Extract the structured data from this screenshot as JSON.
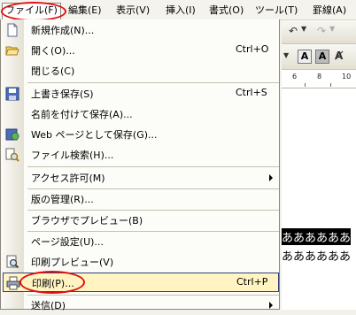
{
  "menubar": {
    "items": [
      {
        "label": "ファイル(F)"
      },
      {
        "label": "編集(E)"
      },
      {
        "label": "表示(V)"
      },
      {
        "label": "挿入(I)"
      },
      {
        "label": "書式(O)"
      },
      {
        "label": "ツール(T)"
      },
      {
        "label": "罫線(A)"
      }
    ]
  },
  "file_menu": {
    "items": [
      {
        "label": "新規作成(N)...",
        "shortcut": "",
        "icon": "new-doc-icon"
      },
      {
        "label": "開く(O)...",
        "shortcut": "Ctrl+O",
        "icon": "open-folder-icon"
      },
      {
        "label": "閉じる(C)",
        "shortcut": ""
      },
      {
        "label": "上書き保存(S)",
        "shortcut": "Ctrl+S",
        "icon": "save-disk-icon"
      },
      {
        "label": "名前を付けて保存(A)...",
        "shortcut": ""
      },
      {
        "label": "Web ページとして保存(G)...",
        "shortcut": "",
        "icon": "web-save-icon"
      },
      {
        "label": "ファイル検索(H)...",
        "shortcut": "",
        "icon": "file-search-icon"
      },
      {
        "label": "アクセス許可(M)",
        "shortcut": "",
        "submenu": true
      },
      {
        "label": "版の管理(R)...",
        "shortcut": ""
      },
      {
        "label": "ブラウザでプレビュー(B)",
        "shortcut": ""
      },
      {
        "label": "ページ設定(U)...",
        "shortcut": ""
      },
      {
        "label": "印刷プレビュー(V)",
        "shortcut": "",
        "icon": "print-preview-icon"
      },
      {
        "label": "印刷(P)...",
        "shortcut": "Ctrl+P",
        "icon": "printer-icon"
      },
      {
        "label": "送信(D)",
        "shortcut": "",
        "submenu": true
      }
    ]
  },
  "ruler": {
    "marks": [
      "6",
      "8",
      "10"
    ]
  },
  "document": {
    "line1": "ああああああ",
    "line2": "ああああああ"
  },
  "colors": {
    "highlight_bg": "#fff4c2",
    "highlight_border": "#30437a",
    "annotation_circle": "#e01010"
  }
}
